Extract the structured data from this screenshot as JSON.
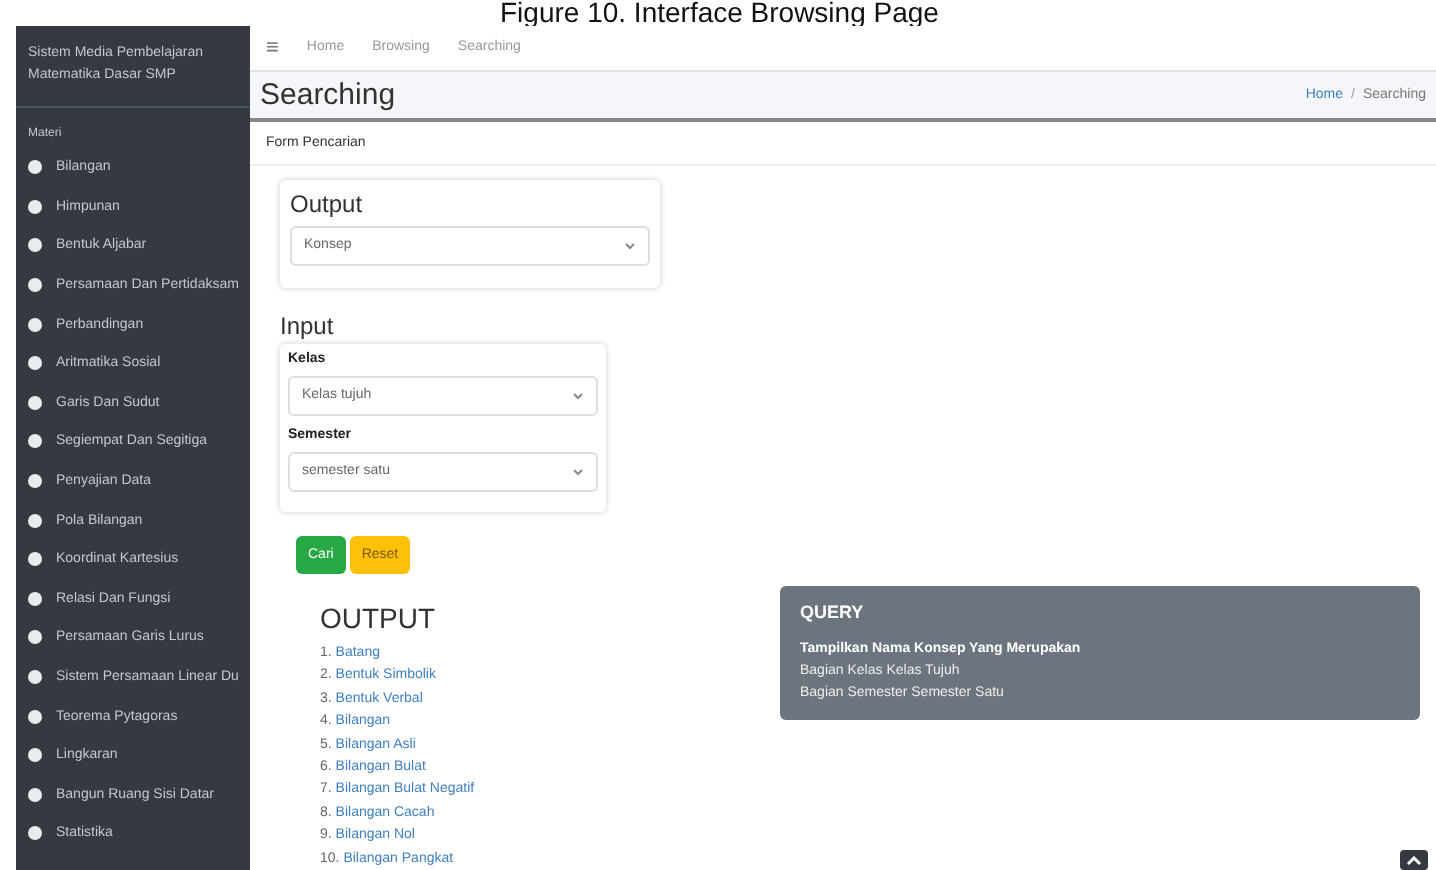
{
  "caption": "Figure 10. Interface Browsing Page",
  "sidebar": {
    "title": "Sistem Media Pembelajaran Matematika Dasar SMP",
    "section": "Materi",
    "items": [
      {
        "label": "Bilangan"
      },
      {
        "label": "Himpunan"
      },
      {
        "label": "Bentuk Aljabar"
      },
      {
        "label": "Persamaan Dan Pertidaksam"
      },
      {
        "label": "Perbandingan"
      },
      {
        "label": "Aritmatika Sosial"
      },
      {
        "label": "Garis Dan Sudut"
      },
      {
        "label": "Segiempat Dan Segitiga"
      },
      {
        "label": "Penyajian Data"
      },
      {
        "label": "Pola Bilangan"
      },
      {
        "label": "Koordinat Kartesius"
      },
      {
        "label": "Relasi Dan Fungsi"
      },
      {
        "label": "Persamaan Garis Lurus"
      },
      {
        "label": "Sistem Persamaan Linear Du"
      },
      {
        "label": "Teorema Pytagoras"
      },
      {
        "label": "Lingkaran"
      },
      {
        "label": "Bangun Ruang Sisi Datar"
      },
      {
        "label": "Statistika"
      }
    ]
  },
  "navbar": {
    "menu_icon": "≡",
    "links": [
      "Home",
      "Browsing",
      "Searching"
    ]
  },
  "header": {
    "title": "Searching",
    "breadcrumb": [
      {
        "label": "Home",
        "link": true
      },
      {
        "label": "Searching",
        "link": false
      }
    ],
    "separator": "/"
  },
  "form": {
    "title": "Form Pencarian",
    "output": {
      "heading": "Output",
      "value": "Konsep"
    },
    "input": {
      "heading": "Input",
      "fields": [
        {
          "label": "Kelas",
          "value": "Kelas tujuh"
        },
        {
          "label": "Semester",
          "value": "semester satu"
        }
      ]
    },
    "buttons": [
      {
        "label": "Cari",
        "kind": "success"
      },
      {
        "label": "Reset",
        "kind": "warning"
      }
    ]
  },
  "results": {
    "heading": "OUTPUT",
    "items": [
      {
        "number": "1.",
        "label": "Batang"
      },
      {
        "number": "2.",
        "label": "Bentuk Simbolik"
      },
      {
        "number": "3.",
        "label": "Bentuk Verbal"
      },
      {
        "number": "4.",
        "label": "Bilangan"
      },
      {
        "number": "5.",
        "label": "Bilangan Asli"
      },
      {
        "number": "6.",
        "label": "Bilangan Bulat"
      },
      {
        "number": "7.",
        "label": "Bilangan Bulat Negatif"
      },
      {
        "number": "8.",
        "label": "Bilangan Cacah"
      },
      {
        "number": "9.",
        "label": "Bilangan Nol"
      },
      {
        "number": "10.",
        "label": "Bilangan Pangkat"
      }
    ]
  },
  "query": {
    "title": "QUERY",
    "lines": [
      "Tampilkan Nama Konsep Yang Merupakan",
      "Bagian Kelas Kelas Tujuh",
      "Bagian Semester Semester Satu"
    ]
  }
}
